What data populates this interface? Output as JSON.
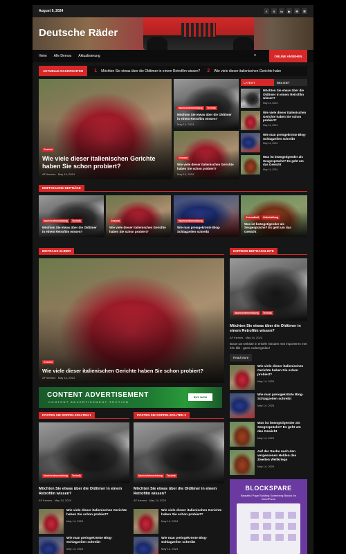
{
  "topbar": {
    "date": "August 9, 2024",
    "socials": [
      "f",
      "X",
      "in",
      "▶",
      "✉",
      "☰"
    ]
  },
  "header": {
    "site_title": "Deutsche Räder"
  },
  "nav": {
    "items": [
      "Heim",
      "Alle Demos",
      "Aktualisierung"
    ],
    "search_icon": "⌕",
    "watch_button": "ONLINE ANSEHEN"
  },
  "ticker": {
    "label": "AKTUELLE NACHRICHTEN",
    "items": [
      {
        "num": "1",
        "text": "Möchten Sie etwas über die Oldtimer in einem Retrofilm wissen?"
      },
      {
        "num": "2",
        "text": "Wie viele dieser italienischen Gerichte habe"
      }
    ]
  },
  "hero": {
    "tag": "Gesicht",
    "title": "Wie viele dieser italienischen Gerichte haben Sie schon probiert?",
    "author": "AF themes",
    "date": "May 14, 2024"
  },
  "grid_posts": [
    {
      "tags": [
        "Nachrichtenmeldung",
        "Technik"
      ],
      "title": "Möchten Sie etwas über die Oldtimer in einem Retrofilm wissen?",
      "date": "May 14, 2024"
    },
    {
      "tags": [
        "Gesicht"
      ],
      "title": "Wie viele dieser italienischen Gerichte haben Sie schon probiert?",
      "date": "May 14, 2024"
    }
  ],
  "side_tabs": {
    "latest": "LATEST",
    "popular": "BELIEBT"
  },
  "side_posts": [
    {
      "title": "Möchten Sie etwas über die Oldtimer in einem Retrofilm wissen?",
      "date": "May 14, 2024"
    },
    {
      "title": "Wie viele dieser italienischen Gerichte haben Sie schon probiert?",
      "date": "May 14, 2024"
    },
    {
      "title": "Wie man preisgekrönte Blog-Schlagzeilen schreibt",
      "date": "May 14, 2024"
    },
    {
      "title": "Was ist beängstigender als Sexgespräche? Es geht um das Gewicht",
      "date": "May 14, 2024"
    }
  ],
  "featured": {
    "label": "EMPFOHLENE BEITRÄGE",
    "items": [
      {
        "tags": [
          "Nachrichtenmeldung",
          "Technik"
        ],
        "title": "Möchten Sie etwas über die Oldtimer in einem Retrofilm wissen?"
      },
      {
        "tags": [
          "Gesicht"
        ],
        "title": "Wie viele dieser italienischen Gerichte haben Sie schon probiert?"
      },
      {
        "tags": [
          "Nachrichtenmeldung"
        ],
        "title": "Wie man preisgekrönte Blog-Schlagzeilen schreibt"
      },
      {
        "tags": [
          "Gesundheit",
          "Unterhaltung"
        ],
        "title": "Was ist beängstigender als Sexgespräche? Es geht um das Gewicht"
      }
    ]
  },
  "slider": {
    "label": "BEITRAGS-SLIDER",
    "tag": "Gesicht",
    "title": "Wie viele dieser italienischen Gerichte haben Sie schon probiert?",
    "author": "AF themes",
    "date": "May 14, 2024"
  },
  "express": {
    "label": "EXPRESS-BEITRAGSLISTE",
    "tags": [
      "Nachrichtenmeldung",
      "Technik"
    ],
    "title": "Möchten Sie etwas über die Oldtimer in einem Retrofilm wissen?",
    "author": "AF themes",
    "date": "May 14, 2024",
    "excerpt": "Bouw uw website in enkele minuten met importeren met één klik - geen codeergedoe!",
    "read_more": "Read More",
    "list": [
      {
        "title": "Wie viele dieser italienischen Gerichte haben Sie schon probiert?",
        "date": "May 14, 2024"
      },
      {
        "title": "Wie man preisgekrönte Blog-Schlagzeilen schreibt",
        "date": "May 14, 2024"
      },
      {
        "title": "Was ist beängstigender als Sexgespräche? Es geht um das Gewicht",
        "date": "May 14, 2024"
      },
      {
        "title": "Auf der Suche nach den vergessenen Helden des Zweiten Weltkriegs",
        "date": "May 14, 2024"
      }
    ]
  },
  "ad": {
    "title": "CONTENT ADVERTISEMENT",
    "subtitle": "CONTENT ADVERTISEMENT SECTION",
    "button": "BUY NOW"
  },
  "double1": {
    "label": "POSTEN SIE DOPPELSPALTEN 1",
    "tags": [
      "Nachrichtenmeldung",
      "Technik"
    ],
    "title": "Möchten Sie etwas über die Oldtimer in einem Retrofilm wissen?",
    "author": "AF themes",
    "date": "May 14, 2024",
    "list": [
      {
        "title": "Wie viele dieser italienischen Gerichte haben Sie schon probiert?",
        "date": "May 14, 2024"
      },
      {
        "title": "Wie man preisgekrönte Blog-Schlagzeilen schreibt",
        "date": "May 14, 2024"
      }
    ]
  },
  "double2": {
    "label": "POSTEN SIE DOPPELSPALTEN 2",
    "tags": [
      "Nachrichtenmeldung",
      "Technik"
    ],
    "title": "Möchten Sie etwas über die Oldtimer in einem Retrofilm wissen?",
    "author": "AF themes",
    "date": "May 14, 2024",
    "list": [
      {
        "title": "Wie viele dieser italienischen Gerichte haben Sie schon probiert?",
        "date": "May 14, 2024"
      },
      {
        "title": "Wie man preisgekrönte Blog-Schlagzeilen schreibt",
        "date": "May 14, 2024"
      }
    ]
  },
  "blockspare": {
    "title": "BLOCKSPARE",
    "subtitle": "Beautiful Page Building Gutenberg Blocks for WordPress"
  },
  "colors": {
    "accent": "#d62828",
    "background": "#161616",
    "ad_green": "#1f7a32",
    "blockspare_purple": "#6a3aa0"
  }
}
